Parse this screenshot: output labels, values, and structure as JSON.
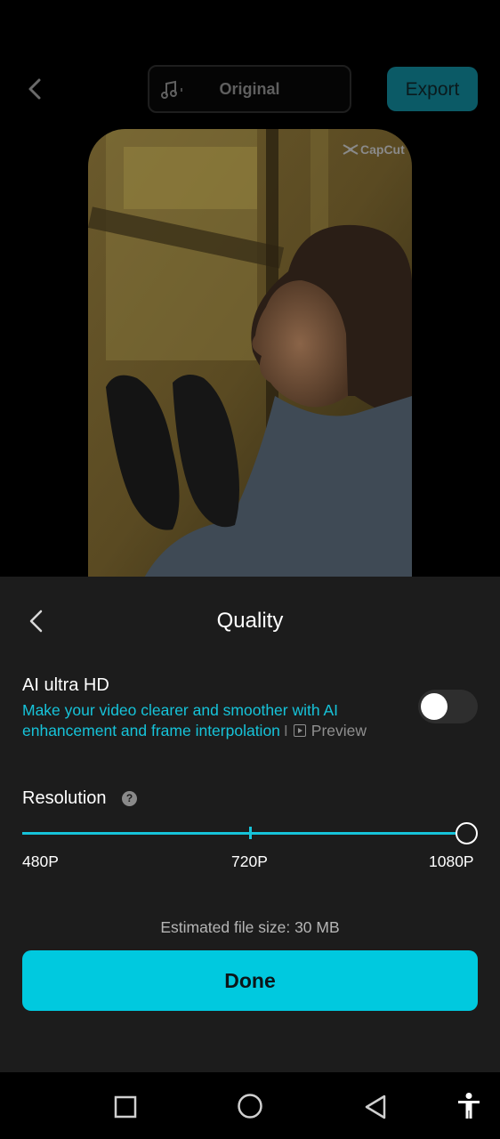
{
  "header": {
    "audio_label": "Original",
    "export_label": "Export",
    "watermark": "CapCut"
  },
  "sheet": {
    "title": "Quality",
    "ai_hd": {
      "title": "AI ultra HD",
      "description": "Make your video clearer and smoother with AI enhancement and frame interpolation",
      "separator": "I",
      "preview_label": "Preview",
      "enabled": false
    },
    "resolution": {
      "label": "Resolution",
      "options": [
        "480P",
        "720P",
        "1080P"
      ],
      "selected": "1080P"
    },
    "file_size": "Estimated file size: 30 MB",
    "done_label": "Done"
  },
  "colors": {
    "accent": "#00c9df",
    "link": "#16c3d9",
    "sheet_bg": "#1c1c1c",
    "export_dimmed": "#0b5a66"
  },
  "icons": [
    "back-arrow-icon",
    "music-note-icon",
    "help-icon",
    "preview-play-icon",
    "nav-recents-icon",
    "nav-home-icon",
    "nav-back-icon",
    "accessibility-icon"
  ]
}
